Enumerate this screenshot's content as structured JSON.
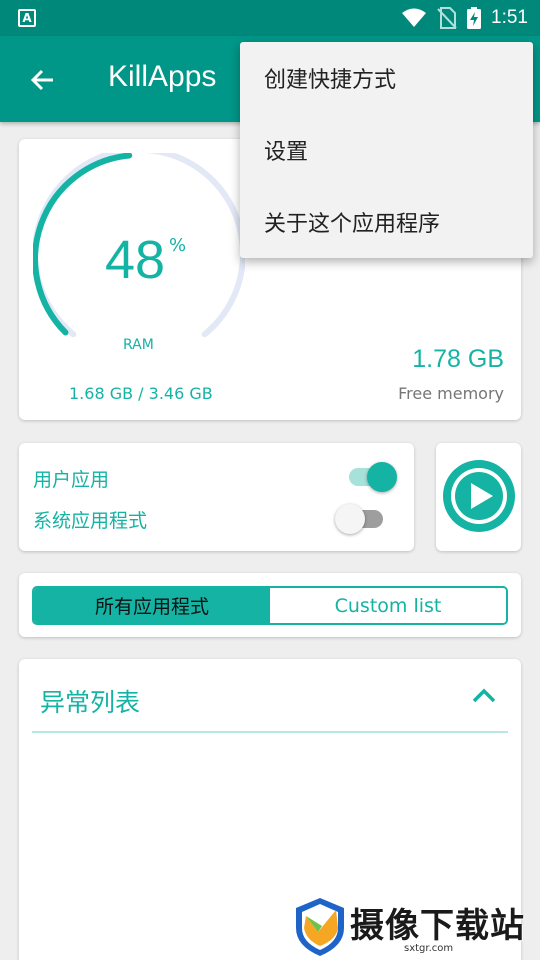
{
  "status_bar": {
    "left_icon_letter": "A",
    "time": "1:51",
    "icons": [
      "wifi-icon",
      "no-sim-icon",
      "battery-charging-icon"
    ]
  },
  "toolbar": {
    "title": "KillApps",
    "back_icon": "arrow-back-icon"
  },
  "ram_card": {
    "percent": "48",
    "percent_value": 48,
    "percent_sign": "%",
    "ram_label": "RAM",
    "used_text": "1.68 GB / 3.46 GB",
    "free_value": "1.78 GB",
    "free_label": "Free memory"
  },
  "toggles": {
    "user_apps_label": "用户应用",
    "user_apps_on": true,
    "system_apps_label": "系统应用程式",
    "system_apps_on": false
  },
  "play_button_icon": "play-circle-icon",
  "segment": {
    "all_apps": "所有应用程式",
    "custom_list": "Custom list",
    "selected": "all_apps"
  },
  "exceptions": {
    "title": "异常列表",
    "chevron_icon": "chevron-up-icon"
  },
  "overflow_menu": {
    "items": [
      "创建快捷方式",
      "设置",
      "关于这个应用程序"
    ]
  },
  "watermark": {
    "text": "摄像下载站",
    "url": "sxtgr.com"
  },
  "colors": {
    "primary": "#009688",
    "status_bar": "#00897b",
    "accent": "#14b3a4",
    "gauge_track": "#e3e8f6"
  }
}
